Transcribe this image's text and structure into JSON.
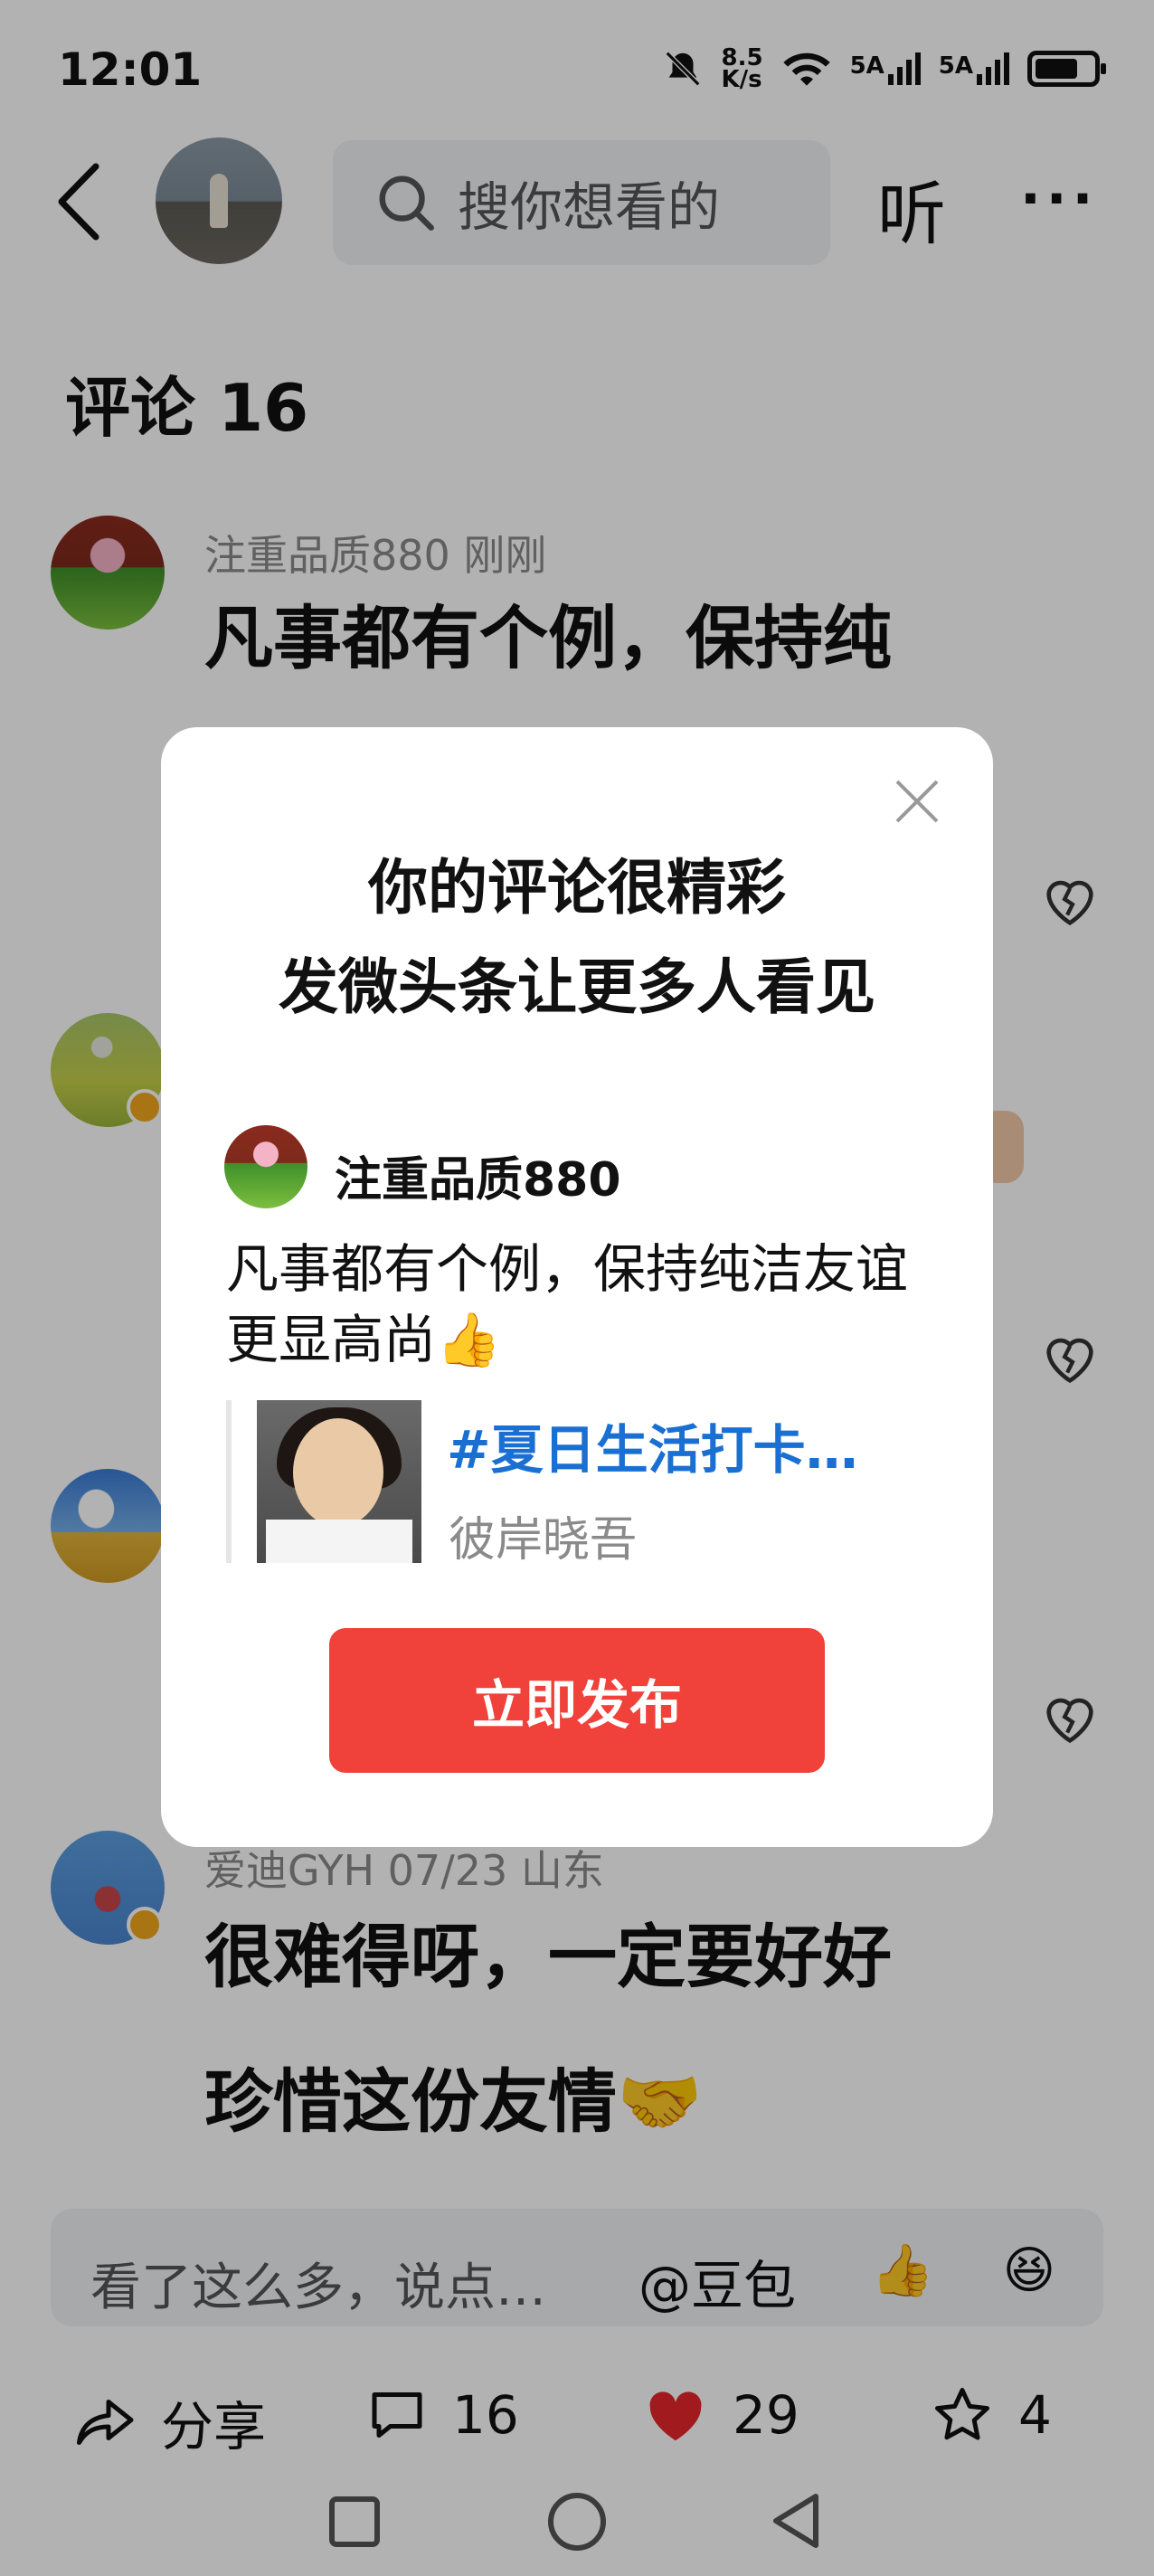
{
  "status_bar": {
    "time": "12:01",
    "net_speed_top": "8.5",
    "net_speed_bottom": "K/s",
    "sim1": "5A",
    "sim2": "5A"
  },
  "header": {
    "search_placeholder": "搜你想看的",
    "listen_label": "听",
    "more_label": "···"
  },
  "comments_title": "评论 16",
  "comments": [
    {
      "user": "注重品质880  刚刚",
      "text": "凡事都有个例，保持纯"
    },
    {
      "user": "爱迪GYH  07/23  山东",
      "text_line1": "很难得呀，一定要好好",
      "text_line2": "珍惜这份友情🤝"
    }
  ],
  "bottom_input": {
    "placeholder": "看了这么多，说点…",
    "mention": "@豆包",
    "emoji1": "👍",
    "emoji2": "😆"
  },
  "actions": {
    "share_label": "分享",
    "comment_count": "16",
    "like_count": "29",
    "favorite_count": "4"
  },
  "modal": {
    "title_line1": "你的评论很精彩",
    "title_line2": "发微头条让更多人看见",
    "user": "注重品质880",
    "comment_text": "凡事都有个例，保持纯洁友谊更显高尚👍",
    "quote_topic": "#夏日生活打卡…",
    "quote_author": "彼岸晓吾",
    "publish_label": "立即发布"
  },
  "colors": {
    "accent_red": "#f0413a",
    "link_blue": "#1a6fd3",
    "like_red": "#e5262b"
  }
}
